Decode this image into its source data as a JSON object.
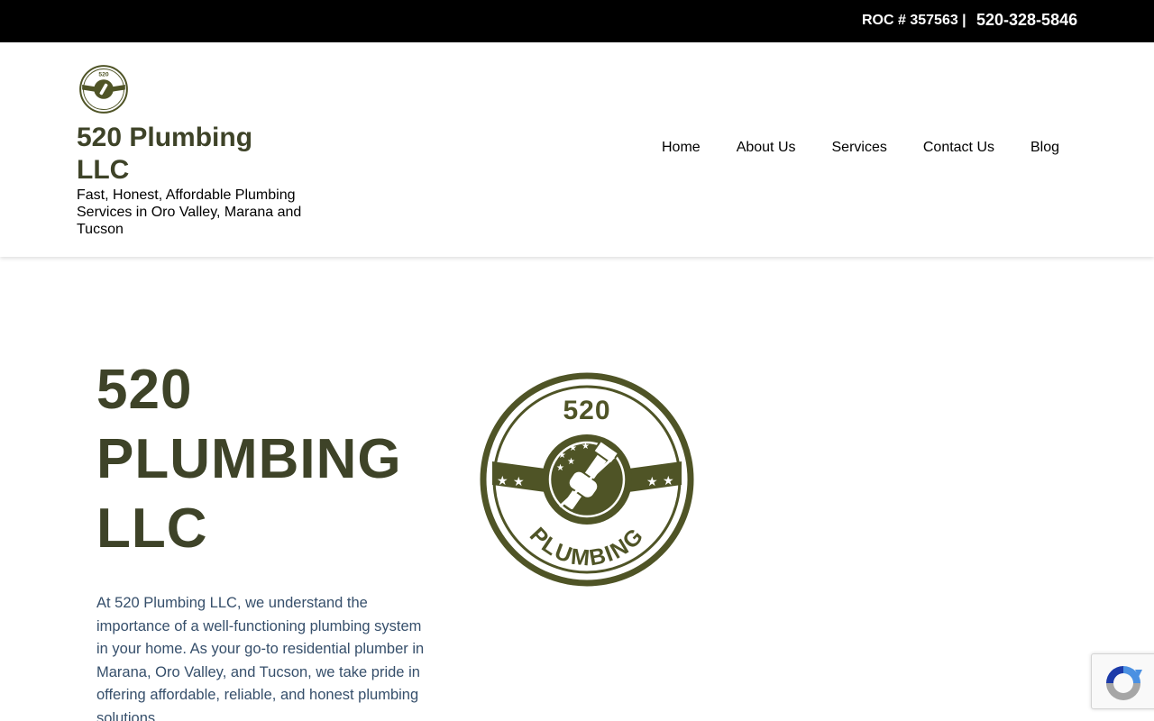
{
  "topbar": {
    "roc": "ROC # 357563 |",
    "phone": "520-328-5846"
  },
  "brand": {
    "name": "520 Plumbing LLC",
    "tagline": "Fast, Honest, Affordable Plumbing Services in Oro Valley, Marana and Tucson",
    "logo_text_top": "520",
    "logo_text_bottom": "PLUMBING",
    "logo_icon": "wrench-fist-badge-icon"
  },
  "nav": {
    "items": [
      {
        "label": "Home"
      },
      {
        "label": "About Us"
      },
      {
        "label": "Services"
      },
      {
        "label": "Contact Us"
      },
      {
        "label": "Blog"
      }
    ]
  },
  "hero": {
    "title": "520 PLUMBING LLC",
    "text": "At 520 Plumbing LLC, we understand the importance of a well-functioning plumbing system in your home. As your go-to residential plumber in Marana, Oro Valley, and Tucson, we take pride in offering affordable, reliable, and honest plumbing solutions."
  },
  "recaptcha": {
    "icon": "recaptcha-icon"
  },
  "colors": {
    "brand_olive": "#3e4328",
    "logo_olive": "#4f5426",
    "body_text": "#364f6b",
    "topbar_bg": "#000000"
  }
}
